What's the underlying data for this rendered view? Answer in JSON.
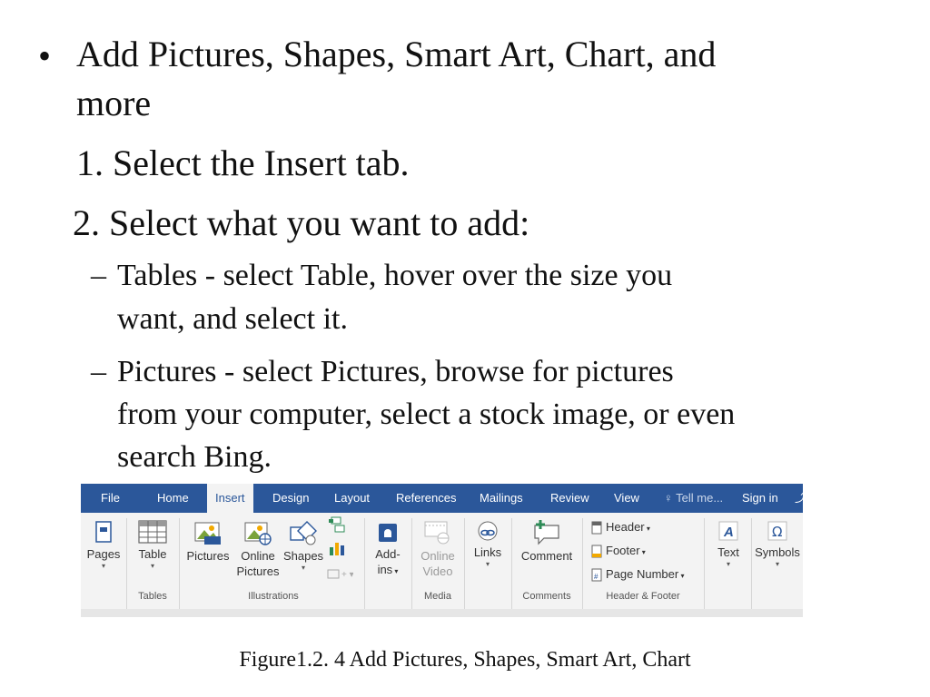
{
  "slide": {
    "bullet_line1": "Add Pictures, Shapes, Smart Art, Chart, and",
    "bullet_line2": "more",
    "step1": "1. Select the Insert tab.",
    "step2": "2. Select what you want to add:",
    "sub1_line1": "Tables - select Table, hover over the size you",
    "sub1_line2": "want, and select it.",
    "sub2_line1": "Pictures - select Pictures, browse for pictures",
    "sub2_line2": "from your computer, select a stock image, or even",
    "sub2_line3": "search Bing.",
    "bullet_glyph": "•",
    "dash_glyph": "–"
  },
  "ribbon": {
    "tabs": [
      "File",
      "Home",
      "Insert",
      "Design",
      "Layout",
      "References",
      "Mailings",
      "Review",
      "View",
      "Tell me...",
      "Sign in"
    ],
    "active_tab": "Insert",
    "pages": {
      "label": "Pages"
    },
    "table": {
      "label": "Table",
      "group": "Tables"
    },
    "pictures": {
      "label": "Pictures"
    },
    "online_pictures": {
      "line1": "Online",
      "line2": "Pictures"
    },
    "shapes": {
      "label": "Shapes"
    },
    "illustrations_group": "Illustrations",
    "addins": {
      "line1": "Add-",
      "line2": "ins"
    },
    "online_video": {
      "line1": "Online",
      "line2": "Video"
    },
    "media_group": "Media",
    "links": {
      "label": "Links"
    },
    "comment": {
      "label": "Comment",
      "group": "Comments"
    },
    "header": {
      "label": "Header"
    },
    "footer": {
      "label": "Footer"
    },
    "page_number": {
      "label": "Page Number"
    },
    "header_footer_group": "Header & Footer",
    "text": {
      "label": "Text"
    },
    "symbols": {
      "label": "Symbols"
    },
    "accent_color": "#2b579a"
  },
  "caption": "Figure1.2. 4 Add Pictures, Shapes, Smart Art, Chart"
}
